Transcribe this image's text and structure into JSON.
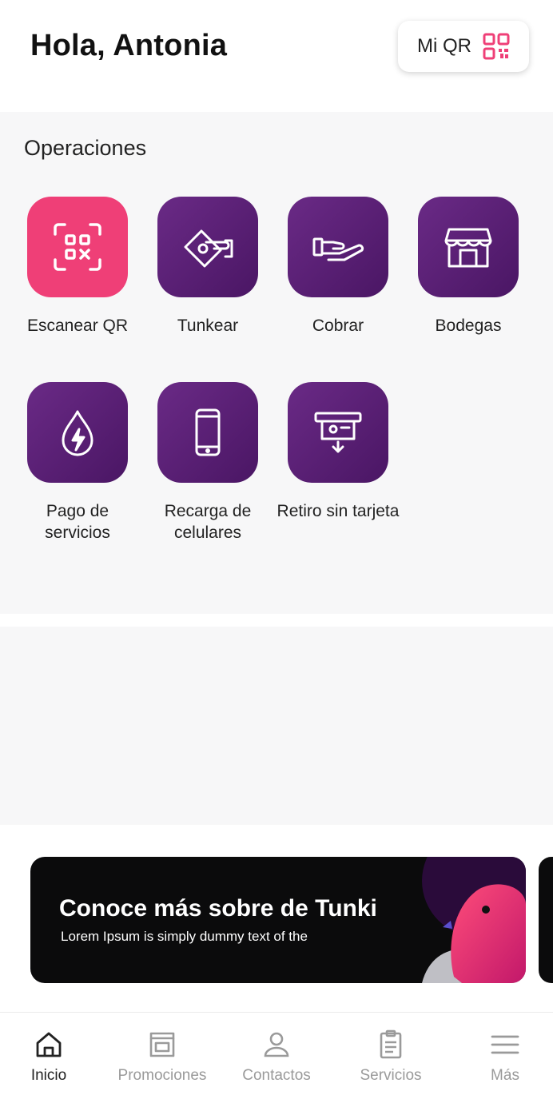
{
  "header": {
    "greeting": "Hola, Antonia",
    "qr_button_label": "Mi QR"
  },
  "operations": {
    "title": "Operaciones",
    "items": [
      {
        "label": "Escanear QR",
        "icon": "scan-qr-icon"
      },
      {
        "label": "Tunkear",
        "icon": "money-hand-icon"
      },
      {
        "label": "Cobrar",
        "icon": "receive-hand-icon"
      },
      {
        "label": "Bodegas",
        "icon": "store-icon"
      },
      {
        "label": "Pago de servicios",
        "icon": "water-energy-icon"
      },
      {
        "label": "Recarga de celulares",
        "icon": "phone-icon"
      },
      {
        "label": "Retiro sin tarjeta",
        "icon": "atm-withdraw-icon"
      }
    ]
  },
  "banner": {
    "title": "Conoce más sobre de Tunki",
    "subtitle": "Lorem Ipsum is simply dummy text of the"
  },
  "bottom_nav": {
    "items": [
      {
        "label": "Inicio",
        "icon": "home-icon",
        "active": true
      },
      {
        "label": "Promociones",
        "icon": "store-icon",
        "active": false
      },
      {
        "label": "Contactos",
        "icon": "person-icon",
        "active": false
      },
      {
        "label": "Servicios",
        "icon": "clipboard-icon",
        "active": false
      },
      {
        "label": "Más",
        "icon": "menu-icon",
        "active": false
      }
    ]
  },
  "colors": {
    "primary_purple": "#5a1f78",
    "accent_pink": "#ef3f77"
  }
}
